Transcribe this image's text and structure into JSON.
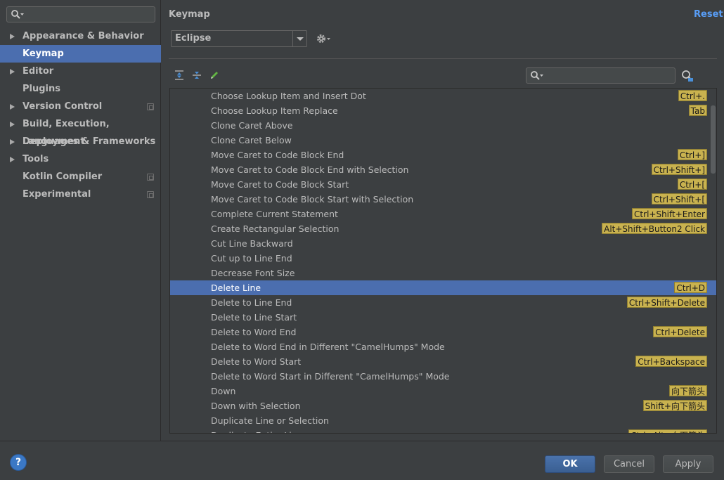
{
  "sidebar": {
    "search": {
      "placeholder": ""
    },
    "items": [
      {
        "label": "Appearance & Behavior",
        "expandable": true,
        "project": false,
        "selected": false
      },
      {
        "label": "Keymap",
        "expandable": false,
        "project": false,
        "selected": true
      },
      {
        "label": "Editor",
        "expandable": true,
        "project": false,
        "selected": false
      },
      {
        "label": "Plugins",
        "expandable": false,
        "project": false,
        "selected": false
      },
      {
        "label": "Version Control",
        "expandable": true,
        "project": true,
        "selected": false
      },
      {
        "label": "Build, Execution, Deployment",
        "expandable": true,
        "project": false,
        "selected": false
      },
      {
        "label": "Languages & Frameworks",
        "expandable": true,
        "project": false,
        "selected": false
      },
      {
        "label": "Tools",
        "expandable": true,
        "project": false,
        "selected": false
      },
      {
        "label": "Kotlin Compiler",
        "expandable": false,
        "project": true,
        "selected": false
      },
      {
        "label": "Experimental",
        "expandable": false,
        "project": true,
        "selected": false
      }
    ]
  },
  "main": {
    "title": "Keymap",
    "reset_label": "Reset",
    "keymap_selected": "Eclipse",
    "search": {
      "placeholder": ""
    }
  },
  "actions": [
    {
      "name": "Choose Lookup Item and Insert Dot",
      "shortcut": "Ctrl+."
    },
    {
      "name": "Choose Lookup Item Replace",
      "shortcut": "Tab"
    },
    {
      "name": "Clone Caret Above",
      "shortcut": ""
    },
    {
      "name": "Clone Caret Below",
      "shortcut": ""
    },
    {
      "name": "Move Caret to Code Block End",
      "shortcut": "Ctrl+]"
    },
    {
      "name": "Move Caret to Code Block End with Selection",
      "shortcut": "Ctrl+Shift+]"
    },
    {
      "name": "Move Caret to Code Block Start",
      "shortcut": "Ctrl+["
    },
    {
      "name": "Move Caret to Code Block Start with Selection",
      "shortcut": "Ctrl+Shift+["
    },
    {
      "name": "Complete Current Statement",
      "shortcut": "Ctrl+Shift+Enter"
    },
    {
      "name": "Create Rectangular Selection",
      "shortcut": "Alt+Shift+Button2 Click"
    },
    {
      "name": "Cut Line Backward",
      "shortcut": ""
    },
    {
      "name": "Cut up to Line End",
      "shortcut": ""
    },
    {
      "name": "Decrease Font Size",
      "shortcut": ""
    },
    {
      "name": "Delete Line",
      "shortcut": "Ctrl+D",
      "selected": true
    },
    {
      "name": "Delete to Line End",
      "shortcut": "Ctrl+Shift+Delete"
    },
    {
      "name": "Delete to Line Start",
      "shortcut": ""
    },
    {
      "name": "Delete to Word End",
      "shortcut": "Ctrl+Delete"
    },
    {
      "name": "Delete to Word End in Different \"CamelHumps\" Mode",
      "shortcut": ""
    },
    {
      "name": "Delete to Word Start",
      "shortcut": "Ctrl+Backspace"
    },
    {
      "name": "Delete to Word Start in Different \"CamelHumps\" Mode",
      "shortcut": ""
    },
    {
      "name": "Down",
      "shortcut": "向下箭头"
    },
    {
      "name": "Down with Selection",
      "shortcut": "Shift+向下箭头"
    },
    {
      "name": "Duplicate Line or Selection",
      "shortcut": ""
    },
    {
      "name": "Duplicate Entire Lines",
      "shortcut": "Ctrl+Alt+向下箭头"
    }
  ],
  "footer": {
    "help_label": "?",
    "ok_label": "OK",
    "cancel_label": "Cancel",
    "apply_label": "Apply"
  },
  "colors": {
    "background": "#3c3f41",
    "selection": "#4b6eaf",
    "link": "#589df6",
    "shortcut_badge": "#c9b24f"
  }
}
